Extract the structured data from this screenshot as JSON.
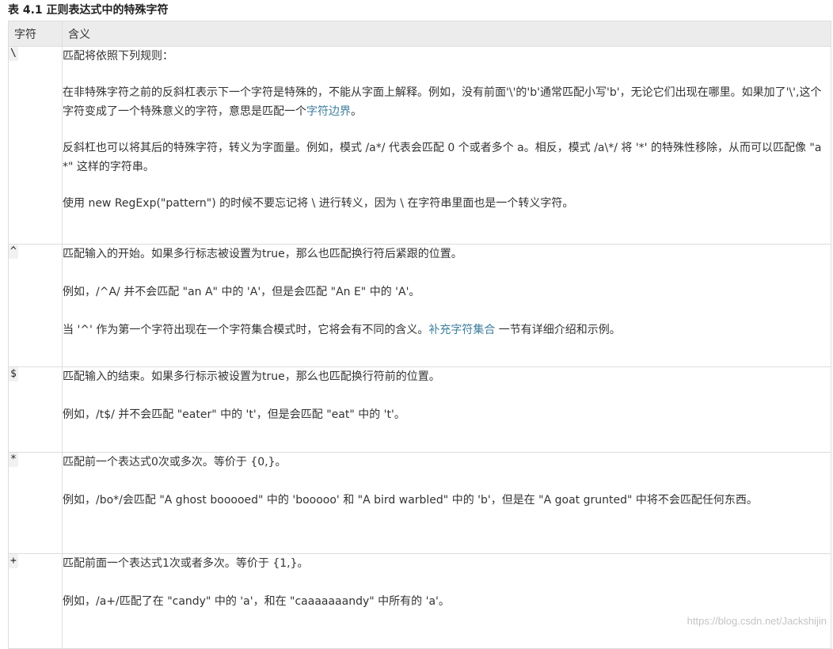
{
  "caption": "表 4.1 正则表达式中的特殊字符",
  "headers": {
    "char": "字符",
    "meaning": "含义"
  },
  "rows": [
    {
      "char": "\\",
      "paras": [
        {
          "text": "匹配将依照下列规则："
        },
        {
          "text_before": "在非特殊字符之前的反斜杠表示下一个字符是特殊的，不能从字面上解释。例如，没有前面'\\'的'b'通常匹配小写'b'，无论它们出现在哪里。如果加了'\\',这个字符变成了一个特殊意义的字符，意思是匹配一个",
          "link": "字符边界",
          "text_after": "。"
        },
        {
          "text": "反斜杠也可以将其后的特殊字符，转义为字面量。例如，模式 /a*/ 代表会匹配 0 个或者多个 a。相反，模式 /a\\*/ 将 '*' 的特殊性移除，从而可以匹配像 \"a*\" 这样的字符串。"
        },
        {
          "text": "使用 new RegExp(\"pattern\") 的时候不要忘记将 \\ 进行转义，因为 \\ 在字符串里面也是一个转义字符。"
        }
      ]
    },
    {
      "char": "^",
      "paras": [
        {
          "text": "匹配输入的开始。如果多行标志被设置为true，那么也匹配换行符后紧跟的位置。"
        },
        {
          "text": "例如，/^A/ 并不会匹配 \"an A\" 中的 'A'，但是会匹配 \"An E\" 中的 'A'。"
        },
        {
          "text_before": "当 '^' 作为第一个字符出现在一个字符集合模式时，它将会有不同的含义。",
          "link": "补充字符集合",
          "text_after": " 一节有详细介绍和示例。"
        }
      ]
    },
    {
      "char": "$",
      "paras": [
        {
          "text": "匹配输入的结束。如果多行标示被设置为true，那么也匹配换行符前的位置。"
        },
        {
          "text": "例如，/t$/ 并不会匹配 \"eater\" 中的 't'，但是会匹配 \"eat\" 中的 't'。"
        }
      ]
    },
    {
      "char": "*",
      "paras": [
        {
          "text": "匹配前一个表达式0次或多次。等价于 {0,}。"
        },
        {
          "text": "例如，/bo*/会匹配 \"A ghost booooed\" 中的 'booooo' 和 \"A bird warbled\" 中的 'b'，但是在 \"A goat grunted\" 中将不会匹配任何东西。"
        }
      ]
    },
    {
      "char": "+",
      "paras": [
        {
          "text": "匹配前面一个表达式1次或者多次。等价于 {1,}。"
        },
        {
          "text": "例如，/a+/匹配了在 \"candy\" 中的 'a'，和在 \"caaaaaaandy\" 中所有的 'a'。"
        }
      ]
    }
  ],
  "watermark": "https://blog.csdn.net/Jackshijin"
}
